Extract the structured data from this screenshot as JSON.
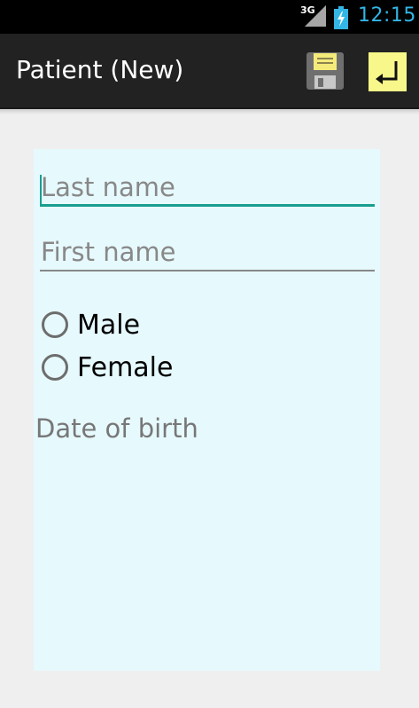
{
  "status_bar": {
    "network": "3G",
    "time": "12:15"
  },
  "action_bar": {
    "title": "Patient (New)",
    "save_icon": "floppy-disk-icon",
    "enter_icon": "enter-return-icon",
    "enter_bg_color": "#f8f88a"
  },
  "form": {
    "last_name_placeholder": "Last name",
    "last_name_value": "",
    "first_name_placeholder": "First name",
    "first_name_value": "",
    "gender_options": [
      "Male",
      "Female"
    ],
    "date_of_birth_label": "Date of birth",
    "accent_color": "#1a9e8f",
    "panel_color": "#e6f9fd"
  }
}
